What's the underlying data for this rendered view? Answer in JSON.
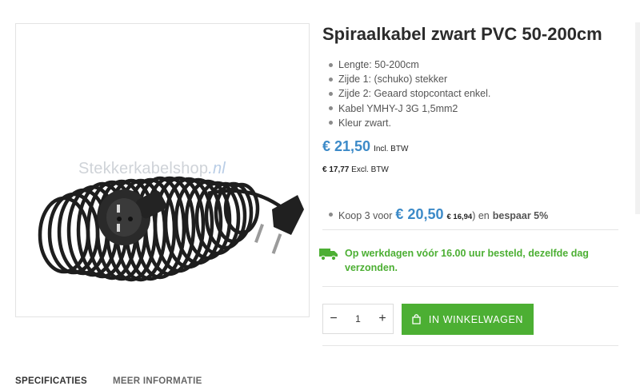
{
  "product": {
    "title": "Spiraalkabel zwart PVC 50-200cm",
    "image_watermark_brand": "Stekkerkabelshop",
    "image_watermark_tld": ".nl",
    "features": [
      "Lengte: 50-200cm",
      "Zijde 1: (schuko) stekker",
      "Zijde 2: Geaard stopcontact enkel.",
      "Kabel YMHY-J 3G 1,5mm2",
      "Kleur zwart."
    ]
  },
  "price": {
    "incl": "€ 21,50",
    "incl_label": "Incl. BTW",
    "excl": "€ 17,77",
    "excl_label": "Excl. BTW"
  },
  "bundle": {
    "prefix": "Koop 3 voor",
    "price": "€ 20,50",
    "excl": "€ 16,94",
    "suffix": ") en",
    "saving": "bespaar 5%"
  },
  "delivery": {
    "icon": "truck-icon",
    "text": "Op werkdagen vóór 16.00 uur besteld, dezelfde dag verzonden."
  },
  "cart": {
    "minus": "−",
    "quantity": "1",
    "plus": "+",
    "button_label": "IN WINKELWAGEN",
    "button_icon": "shopping-bag-icon"
  },
  "tabs": [
    "SPECIFICATIES",
    "MEER INFORMATIE"
  ],
  "colors": {
    "price_blue": "#3c8ac8",
    "accent_green": "#4caf33"
  }
}
